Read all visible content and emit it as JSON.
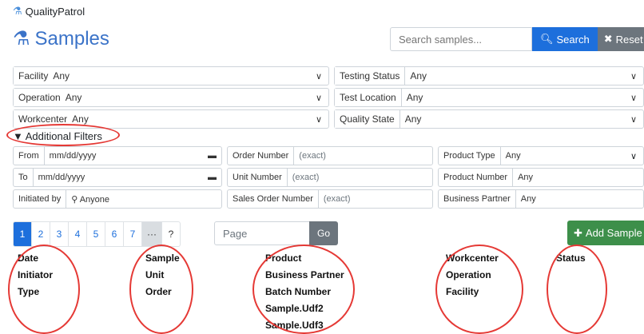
{
  "app": {
    "brand": "QualityPatrol",
    "page_title": "Samples"
  },
  "search": {
    "placeholder": "Search samples...",
    "search_label": "Search",
    "reset_label": "Reset"
  },
  "filters": [
    {
      "label": "Facility",
      "value": "Any"
    },
    {
      "label": "Testing Status",
      "value": "Any"
    },
    {
      "label": "Operation",
      "value": "Any"
    },
    {
      "label": "Test Location",
      "value": "Any"
    },
    {
      "label": "Workcenter",
      "value": "Any"
    },
    {
      "label": "Quality State",
      "value": "Any"
    }
  ],
  "additional_filters": {
    "toggle_label": "▼ Additional Filters",
    "from": {
      "label": "From",
      "value": "mm/dd/yyyy"
    },
    "to": {
      "label": "To",
      "value": "mm/dd/yyyy"
    },
    "initiated_by": {
      "label": "Initiated by",
      "value": "Anyone"
    },
    "order_number": {
      "label": "Order Number",
      "placeholder": "(exact)"
    },
    "unit_number": {
      "label": "Unit Number",
      "placeholder": "(exact)"
    },
    "sales_order_number": {
      "label": "Sales Order Number",
      "placeholder": "(exact)"
    },
    "product_type": {
      "label": "Product Type",
      "value": "Any"
    },
    "product_number": {
      "label": "Product Number",
      "value": "Any"
    },
    "business_partner": {
      "label": "Business Partner",
      "value": "Any"
    }
  },
  "pagination": {
    "pages": [
      "1",
      "2",
      "3",
      "4",
      "5",
      "6",
      "7"
    ],
    "active": "1",
    "ellipsis": "···",
    "help": "?",
    "page_placeholder": "Page",
    "go_label": "Go"
  },
  "add_sample_label": "Add Sample",
  "columns": {
    "col1": [
      "Date",
      "Initiator",
      "Type"
    ],
    "col2": [
      "Sample",
      "Unit",
      "Order"
    ],
    "col3": [
      "Product",
      "Business Partner",
      "Batch Number",
      "Sample.Udf2",
      "Sample.Udf3"
    ],
    "col4": [
      "Workcenter",
      "Operation",
      "Facility"
    ],
    "col5": [
      "Status"
    ]
  },
  "colors": {
    "primary": "#1d6fdc",
    "secondary": "#6c757d",
    "success": "#3d8f4a",
    "annotation": "#e53935"
  }
}
